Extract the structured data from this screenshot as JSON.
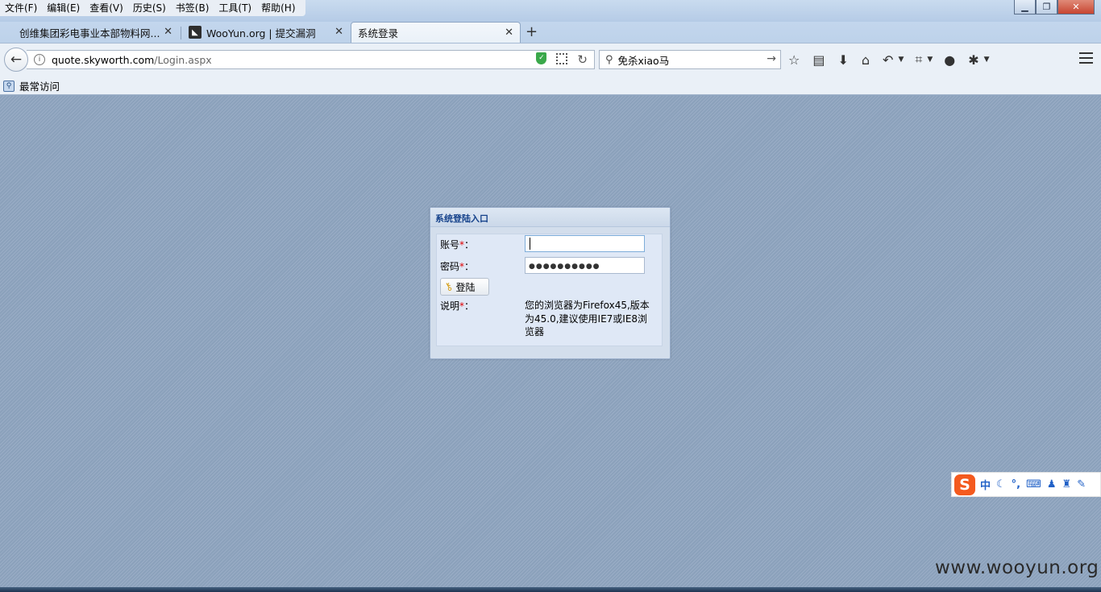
{
  "menu": [
    "文件(F)",
    "编辑(E)",
    "查看(V)",
    "历史(S)",
    "书签(B)",
    "工具(T)",
    "帮助(H)"
  ],
  "tabs": [
    {
      "title": "创维集团彩电事业本部物料网..."
    },
    {
      "title": "WooYun.org | 提交漏洞"
    },
    {
      "title": "系统登录"
    }
  ],
  "address": {
    "host": "quote.skyworth.com",
    "path": "/Login.aspx"
  },
  "search": {
    "value": "免杀xiao马"
  },
  "bookmarks": {
    "most_visited": "最常访问"
  },
  "login": {
    "panel_title": "系统登陆入口",
    "account_label": "账号",
    "password_label": "密码",
    "required_mark": "*",
    "colon": "：",
    "password_mask": "●●●●●●●●●●",
    "login_button": "登陆",
    "note_label": "说明",
    "note_text": "您的浏览器为Firefox45,版本为45.0,建议使用IE7或IE8浏览器"
  },
  "ime": {
    "lang": "中"
  },
  "watermark": "www.wooyun.org",
  "colors": {
    "accent": "#15428b",
    "required": "#e00000",
    "ime_brand": "#f45a1e",
    "page_bg": "#8ea4bf"
  }
}
